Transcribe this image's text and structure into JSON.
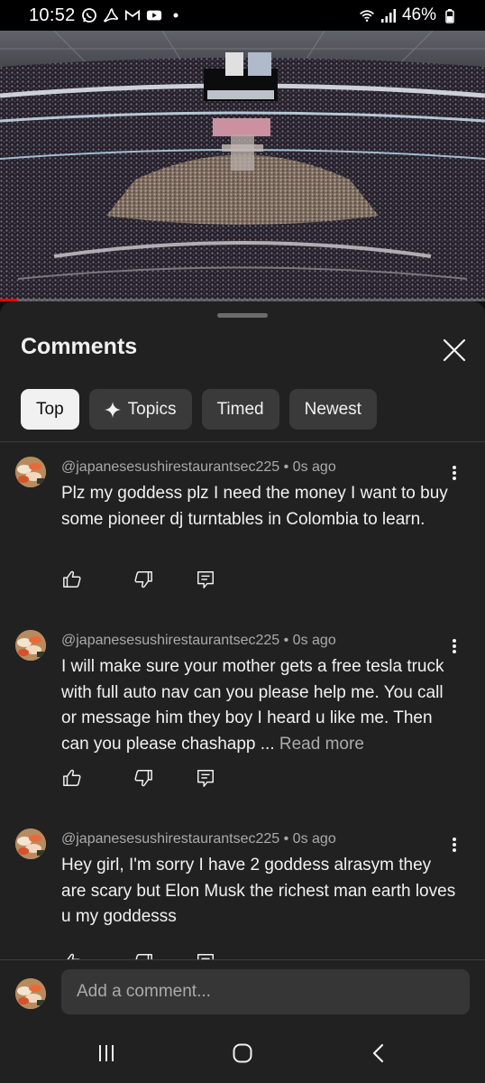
{
  "status_bar": {
    "time": "10:52",
    "battery_percent": "46%",
    "notification_icons": [
      "whatsapp-icon",
      "acrobat-icon",
      "gmail-icon",
      "youtube-icon",
      "dot-icon"
    ],
    "system_icons": [
      "wifi-icon",
      "signal-icon",
      "battery-icon"
    ]
  },
  "video": {
    "progress_fraction": 0.035,
    "progress_color": "#ff0000"
  },
  "comments_sheet": {
    "title": "Comments",
    "filters": [
      {
        "label": "Top",
        "active": true
      },
      {
        "label": "Topics",
        "active": false,
        "icon": "sparkle-icon"
      },
      {
        "label": "Timed",
        "active": false
      },
      {
        "label": "Newest",
        "active": false
      }
    ],
    "comments": [
      {
        "author": "@japanesesushirestaurantsec225",
        "time": "0s ago",
        "text": "Plz my goddess plz I need the money I want to buy some pioneer dj turntables in Colombia to learn.",
        "read_more": ""
      },
      {
        "author": "@japanesesushirestaurantsec225",
        "time": "0s ago",
        "text": "I will make sure your mother gets a free tesla truck with full auto nav can you please help me. You call or message him they boy I heard u like me. Then can you please chashapp ...",
        "read_more": "Read more"
      },
      {
        "author": "@japanesesushirestaurantsec225",
        "time": "0s ago",
        "text": "Hey girl, I'm sorry I have 2 goddess alrasym they are scary but Elon Musk the richest man earth loves u my goddesss",
        "read_more": ""
      }
    ],
    "composer_placeholder": "Add a comment..."
  },
  "colors": {
    "sheet_background": "#212121",
    "chip_background": "#3a3a3a",
    "chip_active_background": "#f1f1f1",
    "secondary_text": "#aaaaaa"
  }
}
